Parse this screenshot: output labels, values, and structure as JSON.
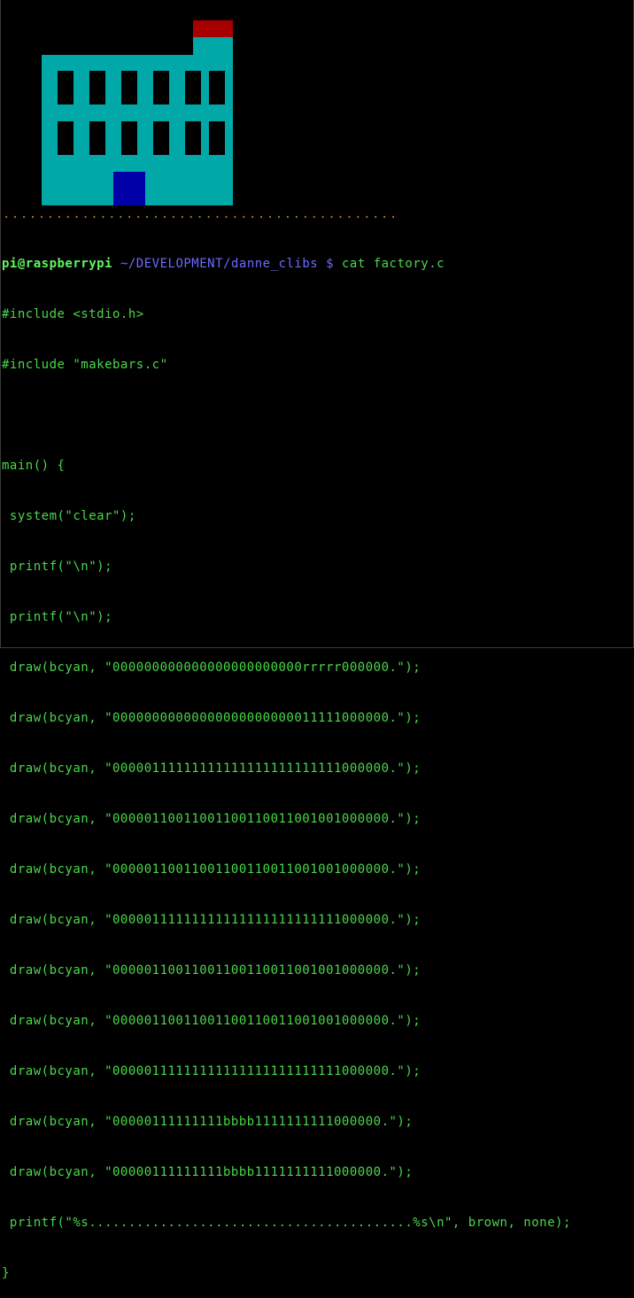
{
  "banner": {
    "dots": "............................................."
  },
  "prompt": {
    "user_host": "pi@raspberrypi",
    "path": "~/DEVELOPMENT/danne_clibs",
    "symbol": "$",
    "command": "cat factory.c"
  },
  "code": [
    "#include <stdio.h>",
    "#include \"makebars.c\"",
    "",
    "main() {",
    " system(\"clear\");",
    " printf(\"\\n\");",
    " printf(\"\\n\");",
    " draw(bcyan, \"000000000000000000000000rrrrr000000.\");",
    " draw(bcyan, \"00000000000000000000000011111000000.\");",
    " draw(bcyan, \"00000111111111111111111111111000000.\");",
    " draw(bcyan, \"00000110011001100110011001001000000.\");",
    " draw(bcyan, \"00000110011001100110011001001000000.\");",
    " draw(bcyan, \"00000111111111111111111111111000000.\");",
    " draw(bcyan, \"00000110011001100110011001001000000.\");",
    " draw(bcyan, \"00000110011001100110011001001000000.\");",
    " draw(bcyan, \"00000111111111111111111111111000000.\");",
    " draw(bcyan, \"00000111111111bbbb1111111111000000.\");",
    " draw(bcyan, \"00000111111111bbbb1111111111000000.\");",
    " printf(\"%s.........................................%s\\n\", brown, none);",
    "}"
  ],
  "colors": {
    "building": "#00a8a8",
    "window": "#000000",
    "door": "#0000a8",
    "chimney_top": "#a80000",
    "terminal_text": "#49d849",
    "prompt_user": "#5ff75f",
    "prompt_path": "#6b6bff",
    "dots": "#b8860b"
  }
}
